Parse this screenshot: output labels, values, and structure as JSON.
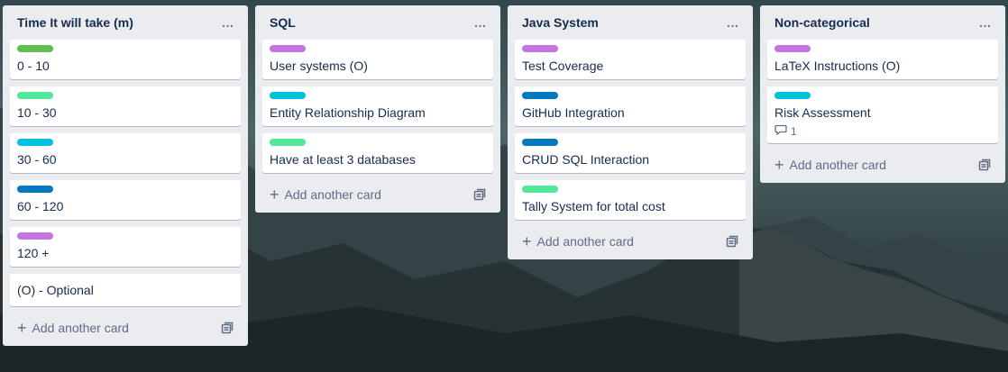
{
  "colors": {
    "list_bg": "#ebecf0",
    "card_bg": "#ffffff",
    "green": "#61bd4f",
    "lime": "#51e898",
    "sky": "#00c2e0",
    "blue": "#0079bf",
    "purple": "#c377e0"
  },
  "lists": [
    {
      "title": "Time It will take (m)",
      "menu": "…",
      "cards": [
        {
          "label_color": "green",
          "title": "0 - 10"
        },
        {
          "label_color": "lime",
          "title": "10 - 30"
        },
        {
          "label_color": "sky",
          "title": "30 - 60"
        },
        {
          "label_color": "blue",
          "title": "60 - 120"
        },
        {
          "label_color": "purple",
          "title": "120 +"
        },
        {
          "label_color": null,
          "title": "(O) - Optional"
        }
      ],
      "add_label": "Add another card"
    },
    {
      "title": "SQL",
      "menu": "…",
      "cards": [
        {
          "label_color": "purple",
          "title": "User systems (O)"
        },
        {
          "label_color": "sky",
          "title": "Entity Relationship Diagram"
        },
        {
          "label_color": "lime",
          "title": "Have at least 3 databases"
        }
      ],
      "add_label": "Add another card"
    },
    {
      "title": "Java System",
      "menu": "…",
      "cards": [
        {
          "label_color": "purple",
          "title": "Test Coverage"
        },
        {
          "label_color": "blue",
          "title": "GitHub Integration"
        },
        {
          "label_color": "blue",
          "title": "CRUD SQL Interaction"
        },
        {
          "label_color": "lime",
          "title": "Tally System for total cost"
        }
      ],
      "add_label": "Add another card"
    },
    {
      "title": "Non-categorical",
      "menu": "…",
      "cards": [
        {
          "label_color": "purple",
          "title": "LaTeX Instructions (O)"
        },
        {
          "label_color": "sky",
          "title": "Risk Assessment",
          "comments": "1"
        }
      ],
      "add_label": "Add another card"
    }
  ]
}
